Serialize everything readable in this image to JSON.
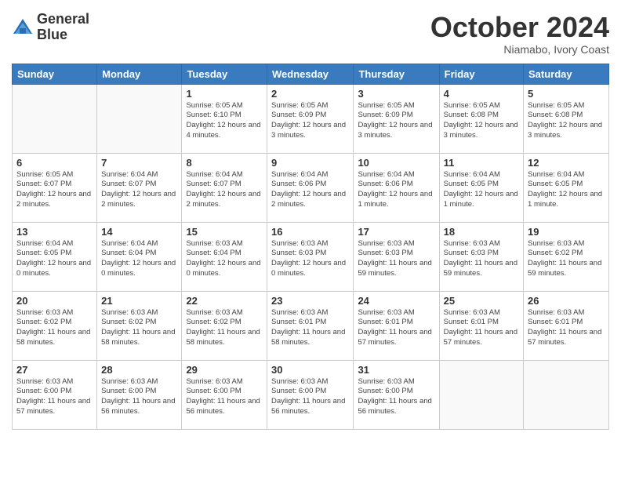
{
  "logo": {
    "line1": "General",
    "line2": "Blue"
  },
  "title": "October 2024",
  "location": "Niamabo, Ivory Coast",
  "weekdays": [
    "Sunday",
    "Monday",
    "Tuesday",
    "Wednesday",
    "Thursday",
    "Friday",
    "Saturday"
  ],
  "weeks": [
    [
      {
        "day": "",
        "info": ""
      },
      {
        "day": "",
        "info": ""
      },
      {
        "day": "1",
        "info": "Sunrise: 6:05 AM\nSunset: 6:10 PM\nDaylight: 12 hours and 4 minutes."
      },
      {
        "day": "2",
        "info": "Sunrise: 6:05 AM\nSunset: 6:09 PM\nDaylight: 12 hours and 3 minutes."
      },
      {
        "day": "3",
        "info": "Sunrise: 6:05 AM\nSunset: 6:09 PM\nDaylight: 12 hours and 3 minutes."
      },
      {
        "day": "4",
        "info": "Sunrise: 6:05 AM\nSunset: 6:08 PM\nDaylight: 12 hours and 3 minutes."
      },
      {
        "day": "5",
        "info": "Sunrise: 6:05 AM\nSunset: 6:08 PM\nDaylight: 12 hours and 3 minutes."
      }
    ],
    [
      {
        "day": "6",
        "info": "Sunrise: 6:05 AM\nSunset: 6:07 PM\nDaylight: 12 hours and 2 minutes."
      },
      {
        "day": "7",
        "info": "Sunrise: 6:04 AM\nSunset: 6:07 PM\nDaylight: 12 hours and 2 minutes."
      },
      {
        "day": "8",
        "info": "Sunrise: 6:04 AM\nSunset: 6:07 PM\nDaylight: 12 hours and 2 minutes."
      },
      {
        "day": "9",
        "info": "Sunrise: 6:04 AM\nSunset: 6:06 PM\nDaylight: 12 hours and 2 minutes."
      },
      {
        "day": "10",
        "info": "Sunrise: 6:04 AM\nSunset: 6:06 PM\nDaylight: 12 hours and 1 minute."
      },
      {
        "day": "11",
        "info": "Sunrise: 6:04 AM\nSunset: 6:05 PM\nDaylight: 12 hours and 1 minute."
      },
      {
        "day": "12",
        "info": "Sunrise: 6:04 AM\nSunset: 6:05 PM\nDaylight: 12 hours and 1 minute."
      }
    ],
    [
      {
        "day": "13",
        "info": "Sunrise: 6:04 AM\nSunset: 6:05 PM\nDaylight: 12 hours and 0 minutes."
      },
      {
        "day": "14",
        "info": "Sunrise: 6:04 AM\nSunset: 6:04 PM\nDaylight: 12 hours and 0 minutes."
      },
      {
        "day": "15",
        "info": "Sunrise: 6:03 AM\nSunset: 6:04 PM\nDaylight: 12 hours and 0 minutes."
      },
      {
        "day": "16",
        "info": "Sunrise: 6:03 AM\nSunset: 6:03 PM\nDaylight: 12 hours and 0 minutes."
      },
      {
        "day": "17",
        "info": "Sunrise: 6:03 AM\nSunset: 6:03 PM\nDaylight: 11 hours and 59 minutes."
      },
      {
        "day": "18",
        "info": "Sunrise: 6:03 AM\nSunset: 6:03 PM\nDaylight: 11 hours and 59 minutes."
      },
      {
        "day": "19",
        "info": "Sunrise: 6:03 AM\nSunset: 6:02 PM\nDaylight: 11 hours and 59 minutes."
      }
    ],
    [
      {
        "day": "20",
        "info": "Sunrise: 6:03 AM\nSunset: 6:02 PM\nDaylight: 11 hours and 58 minutes."
      },
      {
        "day": "21",
        "info": "Sunrise: 6:03 AM\nSunset: 6:02 PM\nDaylight: 11 hours and 58 minutes."
      },
      {
        "day": "22",
        "info": "Sunrise: 6:03 AM\nSunset: 6:02 PM\nDaylight: 11 hours and 58 minutes."
      },
      {
        "day": "23",
        "info": "Sunrise: 6:03 AM\nSunset: 6:01 PM\nDaylight: 11 hours and 58 minutes."
      },
      {
        "day": "24",
        "info": "Sunrise: 6:03 AM\nSunset: 6:01 PM\nDaylight: 11 hours and 57 minutes."
      },
      {
        "day": "25",
        "info": "Sunrise: 6:03 AM\nSunset: 6:01 PM\nDaylight: 11 hours and 57 minutes."
      },
      {
        "day": "26",
        "info": "Sunrise: 6:03 AM\nSunset: 6:01 PM\nDaylight: 11 hours and 57 minutes."
      }
    ],
    [
      {
        "day": "27",
        "info": "Sunrise: 6:03 AM\nSunset: 6:00 PM\nDaylight: 11 hours and 57 minutes."
      },
      {
        "day": "28",
        "info": "Sunrise: 6:03 AM\nSunset: 6:00 PM\nDaylight: 11 hours and 56 minutes."
      },
      {
        "day": "29",
        "info": "Sunrise: 6:03 AM\nSunset: 6:00 PM\nDaylight: 11 hours and 56 minutes."
      },
      {
        "day": "30",
        "info": "Sunrise: 6:03 AM\nSunset: 6:00 PM\nDaylight: 11 hours and 56 minutes."
      },
      {
        "day": "31",
        "info": "Sunrise: 6:03 AM\nSunset: 6:00 PM\nDaylight: 11 hours and 56 minutes."
      },
      {
        "day": "",
        "info": ""
      },
      {
        "day": "",
        "info": ""
      }
    ]
  ]
}
